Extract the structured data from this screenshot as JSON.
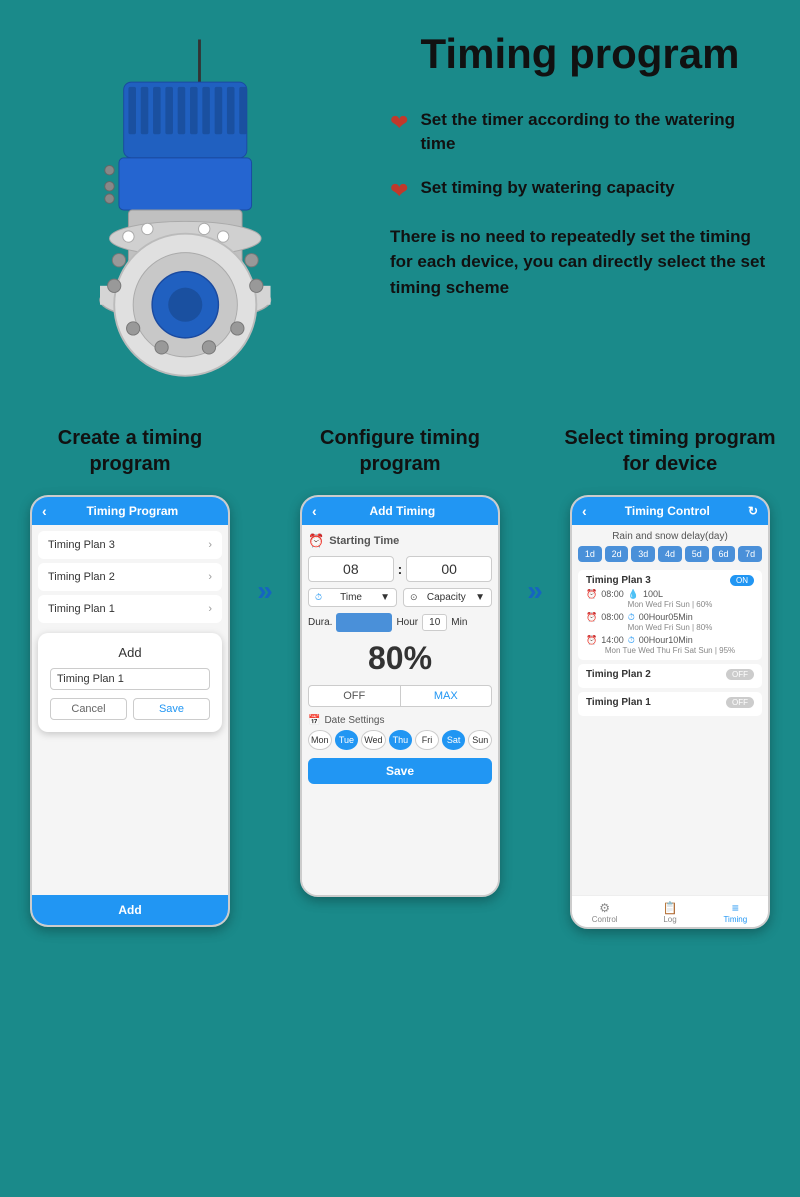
{
  "page": {
    "title": "Timing program",
    "background_color": "#1a8a8a"
  },
  "features": {
    "feature1": "Set the timer according to the watering time",
    "feature2": "Set timing by watering capacity",
    "description": "There is no need to repeatedly set the timing for each device, you can directly select the set timing scheme"
  },
  "steps": {
    "step1": {
      "title": "Create a timing program",
      "phone": {
        "header": "Timing Program",
        "items": [
          "Timing Plan 3",
          "Timing Plan 2",
          "Timing Plan 1"
        ],
        "dialog_title": "Add",
        "dialog_input": "Timing Plan 1",
        "cancel_label": "Cancel",
        "save_label": "Save",
        "footer_label": "Add"
      }
    },
    "step2": {
      "title": "Configure timing program",
      "phone": {
        "header": "Add Timing",
        "starting_time_label": "Starting Time",
        "hour": "08",
        "minute": "00",
        "time_label": "Time",
        "capacity_label": "Capacity",
        "dura_label": "Dura.",
        "hour_label": "Hour",
        "min_value": "10",
        "min_label": "Min",
        "percent": "80%",
        "off_label": "OFF",
        "max_label": "MAX",
        "date_settings_label": "Date Settings",
        "days": [
          {
            "label": "Mon",
            "active": false
          },
          {
            "label": "Tue",
            "active": true
          },
          {
            "label": "Wed",
            "active": false
          },
          {
            "label": "Thu",
            "active": true
          },
          {
            "label": "Fri",
            "active": false
          },
          {
            "label": "Sat",
            "active": true
          },
          {
            "label": "Sun",
            "active": false
          }
        ],
        "save_btn": "Save"
      }
    },
    "step3": {
      "title": "Select timing program for device",
      "phone": {
        "header": "Timing Control",
        "rain_label": "Rain and snow delay(day)",
        "day_pills": [
          "1d",
          "2d",
          "3d",
          "4d",
          "5d",
          "6d",
          "7d"
        ],
        "plans": [
          {
            "name": "Timing Plan 3",
            "toggle": "ON",
            "active": true,
            "entries": [
              {
                "time": "08:00",
                "capacity": "100L",
                "days": "Mon Wed Fri Sun | 60%"
              },
              {
                "time": "08:00",
                "duration": "00Hour05Min",
                "days": "Mon Wed Fri Sun | 80%"
              },
              {
                "time": "14:00",
                "duration": "00Hour10Min",
                "days": "Mon Tue Wed Thu Fri Sat Sun | 95%"
              }
            ]
          },
          {
            "name": "Timing Plan 2",
            "toggle": "OFF",
            "active": false
          },
          {
            "name": "Timing Plan 1",
            "toggle": "OFF",
            "active": false
          }
        ],
        "nav": {
          "control": "Control",
          "log": "Log",
          "timing": "Timing"
        }
      }
    }
  }
}
